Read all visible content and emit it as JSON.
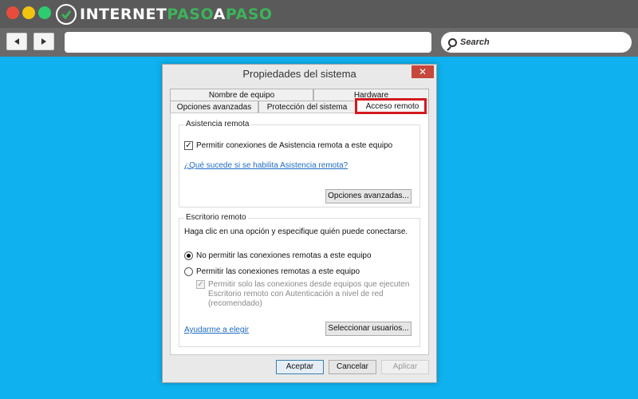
{
  "browser": {
    "logo": {
      "part1": "INTERNET",
      "part2": "PASO",
      "part3": "A",
      "part4": "PASO"
    },
    "search": {
      "placeholder": "Search"
    },
    "colors": {
      "close": "#e84c3d",
      "minimize": "#f1c40f",
      "maximize": "#2ecc71"
    }
  },
  "dialog": {
    "title": "Propiedades del sistema",
    "close_icon": "✕",
    "tabs": {
      "row1": [
        "Nombre de equipo",
        "Hardware"
      ],
      "row2": [
        "Opciones avanzadas",
        "Protección del sistema",
        "Acceso remoto"
      ]
    },
    "asistencia": {
      "label": "Asistencia remota",
      "checkbox_label": "Permitir conexiones de Asistencia remota a este equipo",
      "link": "¿Qué sucede si se habilita Asistencia remota?",
      "button": "Opciones avanzadas..."
    },
    "escritorio": {
      "label": "Escritorio remoto",
      "instructions": "Haga clic en una opción y especifique quién puede conectarse.",
      "radio1": "No permitir las conexiones remotas a este equipo",
      "radio2": "Permitir las conexiones remotas a este equipo",
      "nla_line1": "Permitir solo las conexiones desde equipos que ejecuten",
      "nla_line2": "Escritorio remoto con Autenticación a nivel de red",
      "nla_line3": "(recomendado)",
      "help_link": "Ayudarme a elegir",
      "select_button": "Seleccionar usuarios..."
    },
    "footer": {
      "ok": "Aceptar",
      "cancel": "Cancelar",
      "apply": "Aplicar"
    }
  }
}
